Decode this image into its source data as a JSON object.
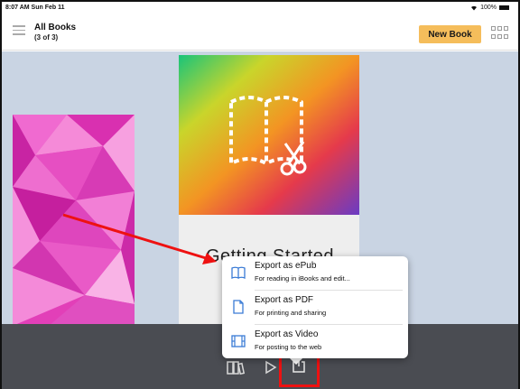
{
  "status": {
    "time": "8:07 AM  Sun Feb 11",
    "battery": "100%"
  },
  "nav": {
    "title": "All Books",
    "subtitle": "(3 of 3)",
    "new_book_label": "New Book"
  },
  "book": {
    "title": "Getting Started"
  },
  "export_menu": {
    "items": [
      {
        "title": "Export as ePub",
        "subtitle": "For reading in iBooks and edit...",
        "icon": "book-icon"
      },
      {
        "title": "Export as PDF",
        "subtitle": "For printing and sharing",
        "icon": "document-icon"
      },
      {
        "title": "Export as Video",
        "subtitle": "For posting to the web",
        "icon": "film-icon"
      }
    ]
  },
  "toolbar": {
    "icons": [
      "library-icon",
      "play-icon",
      "share-icon"
    ]
  },
  "colors": {
    "accent": "#f5bd5b",
    "menu_icon_blue": "#3a7bd5",
    "annotation_red": "#e11111",
    "main_bg": "#c9d4e3",
    "toolbar_bg": "#4a4c52"
  }
}
